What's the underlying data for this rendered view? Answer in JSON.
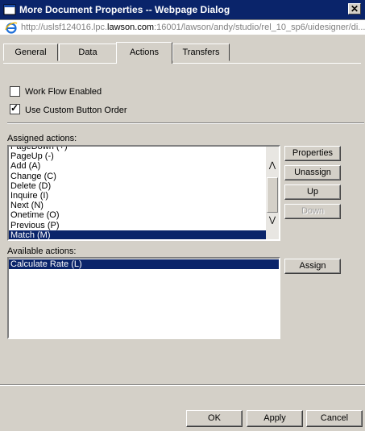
{
  "window": {
    "title": "More Document Properties -- Webpage Dialog",
    "close_symbol": "✕",
    "url_prefix": "http://uslsf124016.lpc.",
    "url_domain": "lawson.com",
    "url_suffix": ":16001/lawson/andy/studio/rel_10_sp6/uidesigner/di..."
  },
  "tabs": [
    {
      "label": "General",
      "active": false
    },
    {
      "label": "Data",
      "active": false
    },
    {
      "label": "Actions",
      "active": true
    },
    {
      "label": "Transfers",
      "active": false
    }
  ],
  "options": {
    "workflow": {
      "label": "Work Flow Enabled",
      "checked": false
    },
    "custom_order": {
      "label": "Use Custom Button Order",
      "checked": true,
      "mark": "✓"
    }
  },
  "assigned": {
    "label": "Assigned actions:",
    "items": [
      "PageDown (+)",
      "PageUp (-)",
      "Add (A)",
      "Change (C)",
      "Delete (D)",
      "Inquire (I)",
      "Next (N)",
      "Onetime (O)",
      "Previous (P)",
      "Match (M)"
    ],
    "selected": "Match (M)",
    "scroll_up": "⋀",
    "scroll_down": "⋁"
  },
  "available": {
    "label": "Available actions:",
    "items": [
      "Calculate Rate (L)"
    ],
    "selected": "Calculate Rate (L)"
  },
  "buttons": {
    "properties": "Properties",
    "unassign": "Unassign",
    "up": "Up",
    "down": "Down",
    "assign": "Assign",
    "ok": "OK",
    "apply": "Apply",
    "cancel": "Cancel"
  },
  "icons": {
    "title_icon": "dialog-icon",
    "address_icon": "internet-explorer-icon"
  }
}
